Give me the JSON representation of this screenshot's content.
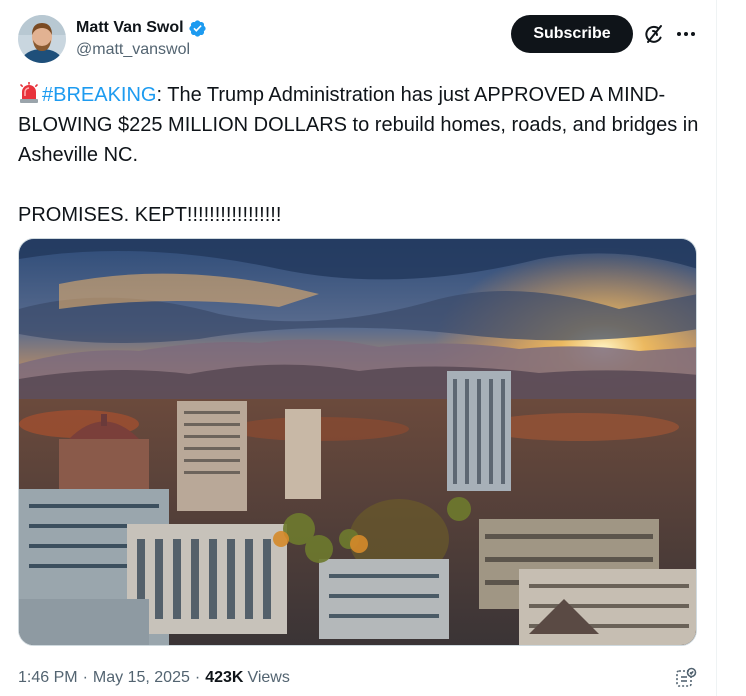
{
  "author": {
    "display_name": "Matt Van Swol",
    "handle": "@matt_vanswol",
    "verified": true
  },
  "header": {
    "subscribe_label": "Subscribe"
  },
  "tweet": {
    "hashtag": "#BREAKING",
    "line1_rest": ": The Trump Administration has just APPROVED A MIND-BLOWING $225 MILLION DOLLARS to rebuild homes, roads, and bridges in Asheville NC.",
    "line2": "PROMISES. KEPT!!!!!!!!!!!!!!!!!"
  },
  "footer": {
    "time": "1:46 PM",
    "separator": "·",
    "date": "May 15, 2025",
    "views_count": "423K",
    "views_label": "Views"
  },
  "icons": {
    "siren": "police-siren-emoji",
    "verified": "verified-badge-icon",
    "grok": "grok-icon",
    "more": "more-horizontal-icon",
    "analytics": "analytics-icon"
  },
  "colors": {
    "accent": "#1d9bf0",
    "text": "#0f1419",
    "secondary": "#536471",
    "button_bg": "#0f1419"
  }
}
